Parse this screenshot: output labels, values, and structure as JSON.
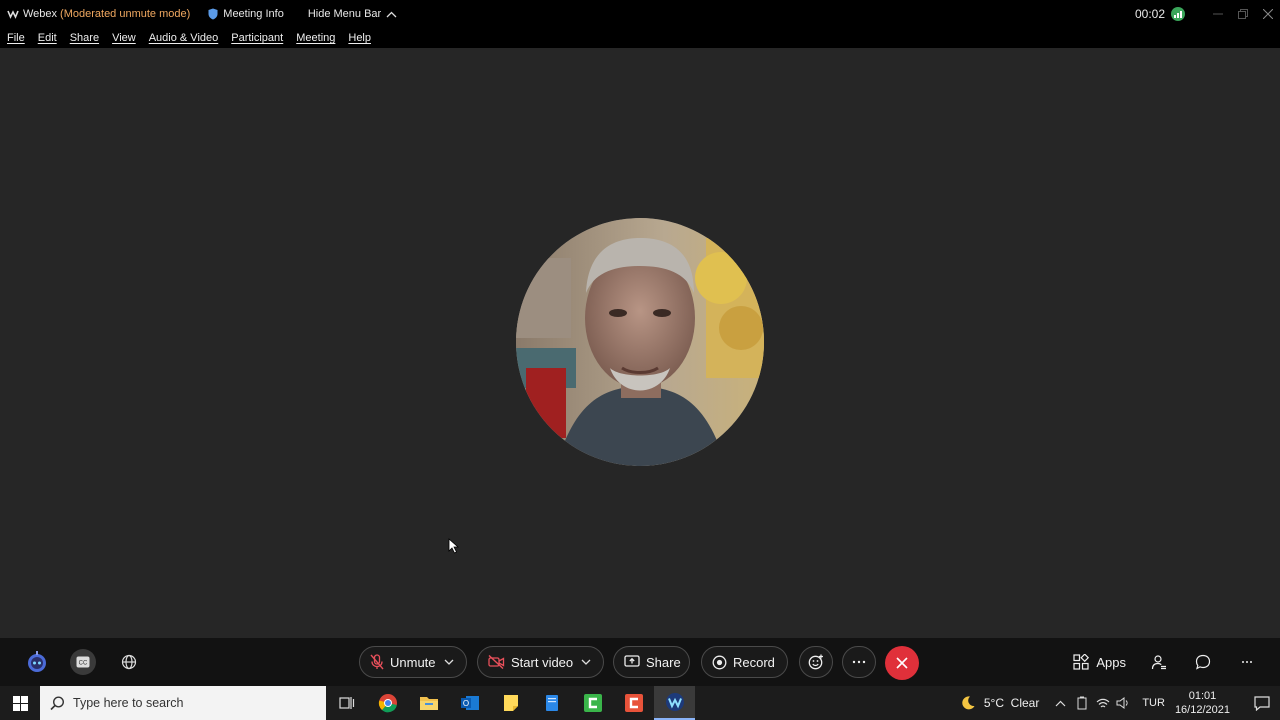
{
  "titlebar": {
    "app_name": "Webex",
    "mode": "(Moderated unmute mode)",
    "meeting_info": "Meeting Info",
    "hide_menu_bar": "Hide Menu Bar",
    "timer": "00:02"
  },
  "menu": [
    "File",
    "Edit",
    "Share",
    "View",
    "Audio & Video",
    "Participant",
    "Meeting",
    "Help"
  ],
  "controls": {
    "unmute": "Unmute",
    "start_video": "Start video",
    "share": "Share",
    "record": "Record",
    "apps": "Apps"
  },
  "taskbar": {
    "search_placeholder": "Type here to search",
    "weather": "5°C  Clear",
    "language": "TUR",
    "time": "01:01",
    "date": "16/12/2021"
  },
  "icons": {
    "leave": "close-icon",
    "mute_state": "muted-mic-icon",
    "video_state": "video-off-icon"
  },
  "colors": {
    "leave_red": "#e0303a",
    "mute_red": "#e8505b",
    "mode_orange": "#f0a860",
    "status_green": "#3aa55a"
  }
}
